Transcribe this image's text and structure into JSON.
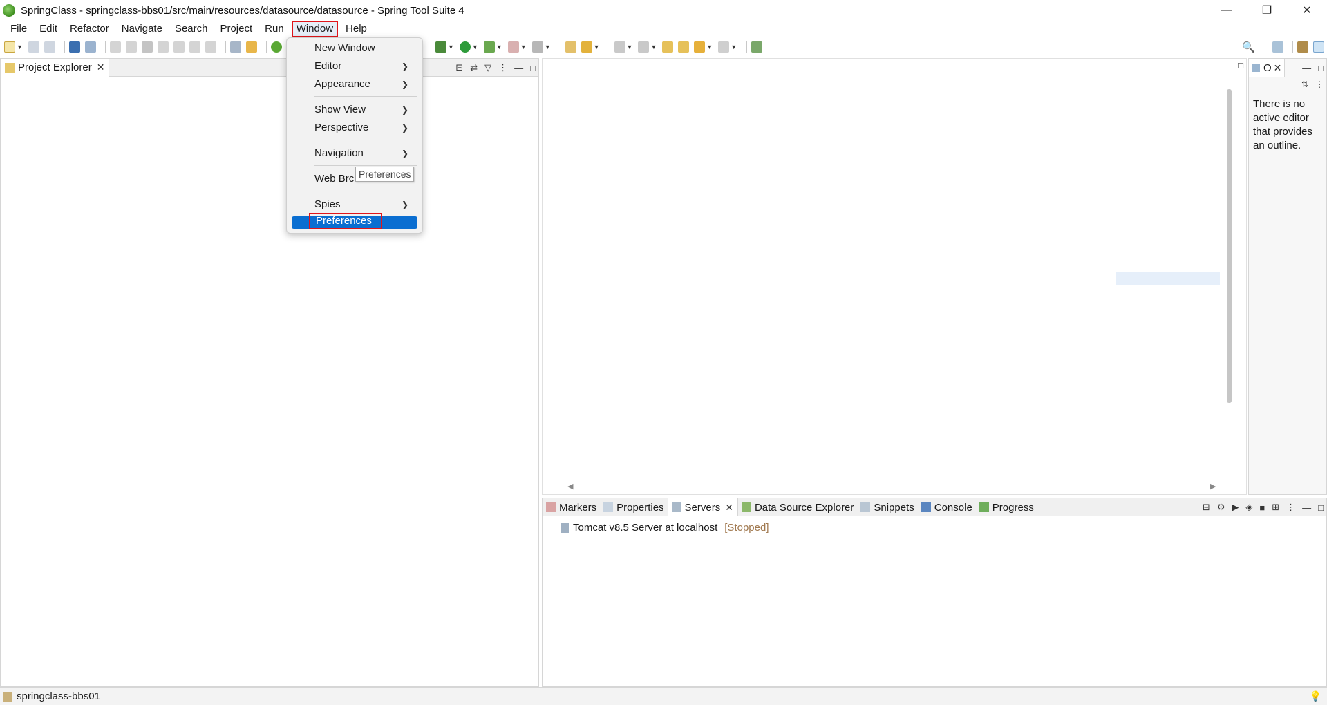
{
  "window": {
    "title": "SpringClass - springclass-bbs01/src/main/resources/datasource/datasource - Spring Tool Suite 4",
    "controls": [
      "minimize",
      "restore",
      "close"
    ]
  },
  "menubar": {
    "items": [
      "File",
      "Edit",
      "Refactor",
      "Navigate",
      "Search",
      "Project",
      "Run",
      "Window",
      "Help"
    ],
    "active": "Window"
  },
  "window_menu": {
    "items": [
      {
        "label": "New Window",
        "submenu": false
      },
      {
        "label": "Editor",
        "submenu": true
      },
      {
        "label": "Appearance",
        "submenu": true
      },
      {
        "label": "Show View",
        "submenu": true
      },
      {
        "label": "Perspective",
        "submenu": true
      },
      {
        "label": "Navigation",
        "submenu": true
      },
      {
        "label": "Web Brc",
        "submenu": false
      },
      {
        "label": "Spies",
        "submenu": true
      },
      {
        "label": "Preferences",
        "submenu": false,
        "highlighted": true
      }
    ],
    "tooltip": "Preferences"
  },
  "project_explorer": {
    "tab_label": "Project Explorer"
  },
  "outline": {
    "tab_label": "O",
    "message": "There is no active editor that provides an outline."
  },
  "bottom_panel": {
    "tabs": [
      "Markers",
      "Properties",
      "Servers",
      "Data Source Explorer",
      "Snippets",
      "Console",
      "Progress"
    ],
    "active_tab": "Servers",
    "servers": [
      {
        "name": "Tomcat v8.5 Server at localhost",
        "status": "[Stopped]"
      }
    ]
  },
  "statusbar": {
    "text": "springclass-bbs01"
  },
  "colors": {
    "highlight_red": "#e0151b",
    "selection_blue": "#0a6ed1",
    "stopped_text": "#a0784e"
  }
}
